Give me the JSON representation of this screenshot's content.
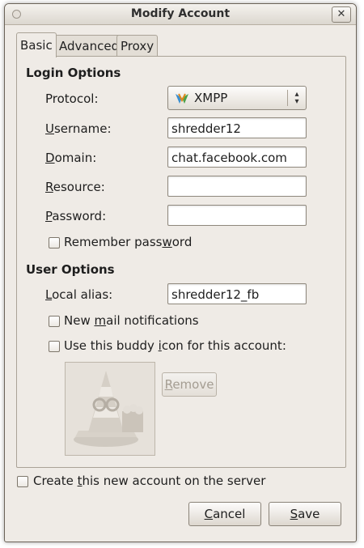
{
  "window": {
    "title": "Modify Account"
  },
  "tabs": [
    {
      "label": "Basic"
    },
    {
      "label": "Advanced"
    },
    {
      "label": "Proxy"
    }
  ],
  "login_options": {
    "heading": "Login Options",
    "protocol_label": "Protocol:",
    "protocol_value": "XMPP",
    "username_label": "Username:",
    "username_value": "shredder12",
    "domain_label": "Domain:",
    "domain_value": "chat.facebook.com",
    "resource_label": "Resource:",
    "resource_value": "",
    "password_label": "Password:",
    "password_value": "",
    "remember_label": "Remember password",
    "remember_checked": false
  },
  "user_options": {
    "heading": "User Options",
    "alias_label": "Local alias:",
    "alias_value": "shredder12_fb",
    "mail_label": "New mail notifications",
    "mail_checked": false,
    "buddy_icon_label": "Use this buddy icon for this account:",
    "buddy_icon_checked": false,
    "remove_label": "Remove"
  },
  "footer": {
    "create_label": "Create this new account on the server",
    "create_checked": false,
    "cancel_label": "Cancel",
    "save_label": "Save"
  },
  "colors": {
    "window_bg": "#efebe6",
    "border": "#8a8378"
  }
}
